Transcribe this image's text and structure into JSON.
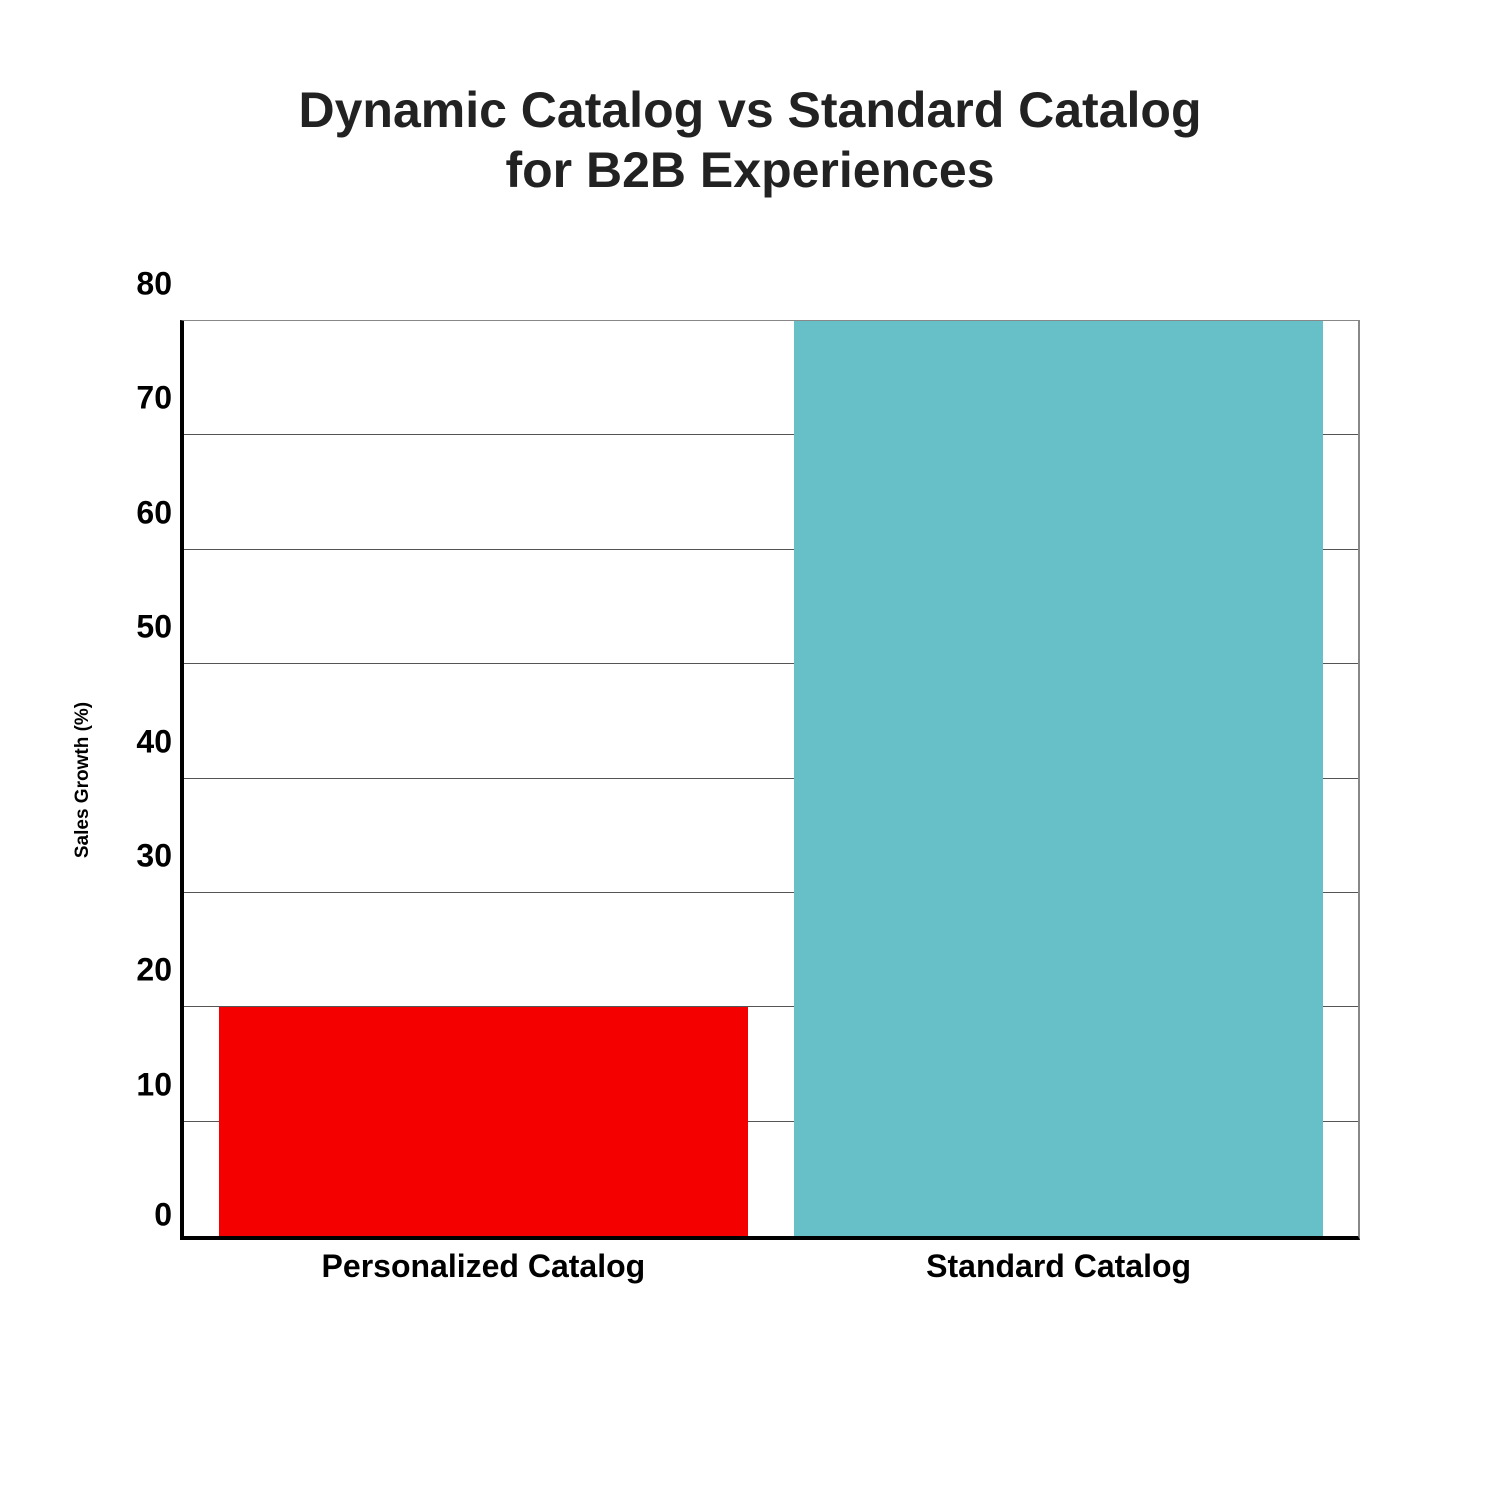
{
  "chart_data": {
    "type": "bar",
    "title": "Dynamic Catalog vs Standard Catalog\nfor B2B Experiences",
    "categories": [
      "Personalized Catalog",
      "Standard Catalog"
    ],
    "values": [
      20,
      80
    ],
    "colors": [
      "#f40000",
      "#67bfc7"
    ],
    "ylabel": "Sales Growth (%)",
    "xlabel": "",
    "ylim": [
      0,
      80
    ],
    "yticks": [
      0,
      10,
      20,
      30,
      40,
      50,
      60,
      70,
      80
    ]
  }
}
